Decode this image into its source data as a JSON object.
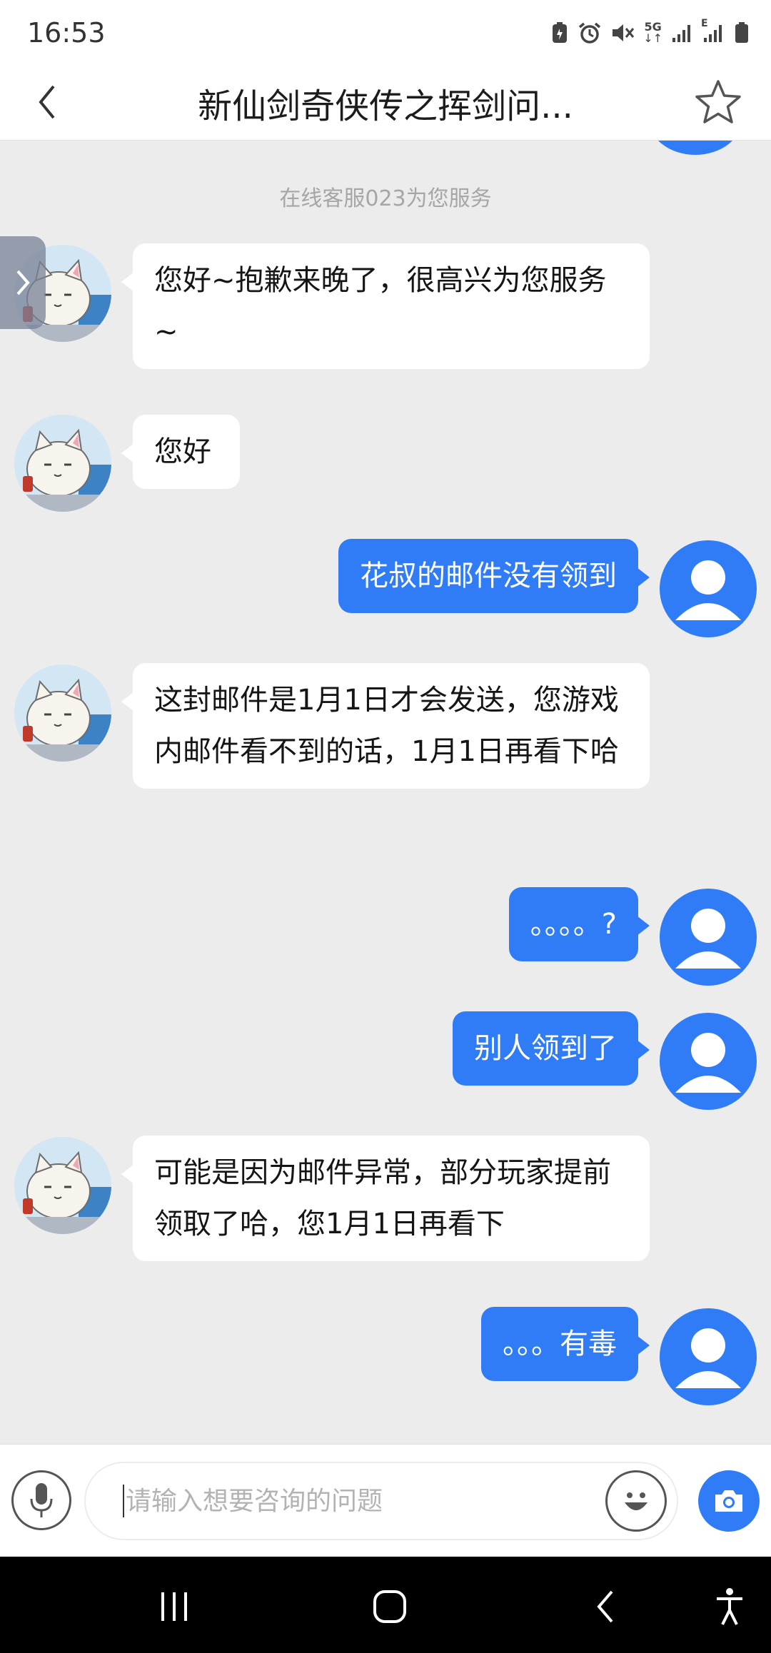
{
  "status_bar": {
    "time": "16:53",
    "network_label": "5G",
    "signal_label": "E",
    "icons": [
      "battery-saver-icon",
      "alarm-icon",
      "mute-icon",
      "data-arrows-icon",
      "signal-icon",
      "signal-icon-2",
      "battery-icon"
    ]
  },
  "header": {
    "title": "新仙剑奇侠传之挥剑问...",
    "back_icon": "chevron-left-icon",
    "favorite_icon": "star-outline-icon"
  },
  "chat": {
    "system_note": "在线客服023为您服务",
    "messages": [
      {
        "from": "agent",
        "text": "您好~抱歉来晚了，很高兴为您服务~"
      },
      {
        "from": "agent",
        "text": "您好"
      },
      {
        "from": "user",
        "text": "花叔的邮件没有领到"
      },
      {
        "from": "agent",
        "text": "这封邮件是1月1日才会发送，您游戏内邮件看不到的话，1月1日再看下哈"
      },
      {
        "from": "user",
        "text": "。。。。?"
      },
      {
        "from": "user",
        "text": "别人领到了"
      },
      {
        "from": "agent",
        "text": "可能是因为邮件异常，部分玩家提前领取了哈，您1月1日再看下"
      },
      {
        "from": "user",
        "text": "。。。有毒"
      }
    ]
  },
  "input_bar": {
    "placeholder": "请输入想要咨询的问题",
    "value": "",
    "icons": [
      "microphone-icon",
      "emoji-icon",
      "camera-icon"
    ]
  },
  "colors": {
    "accent": "#2f7cf6",
    "background": "#ececed",
    "agent_bubble": "#ffffff",
    "system_text": "#a6a6a6"
  }
}
